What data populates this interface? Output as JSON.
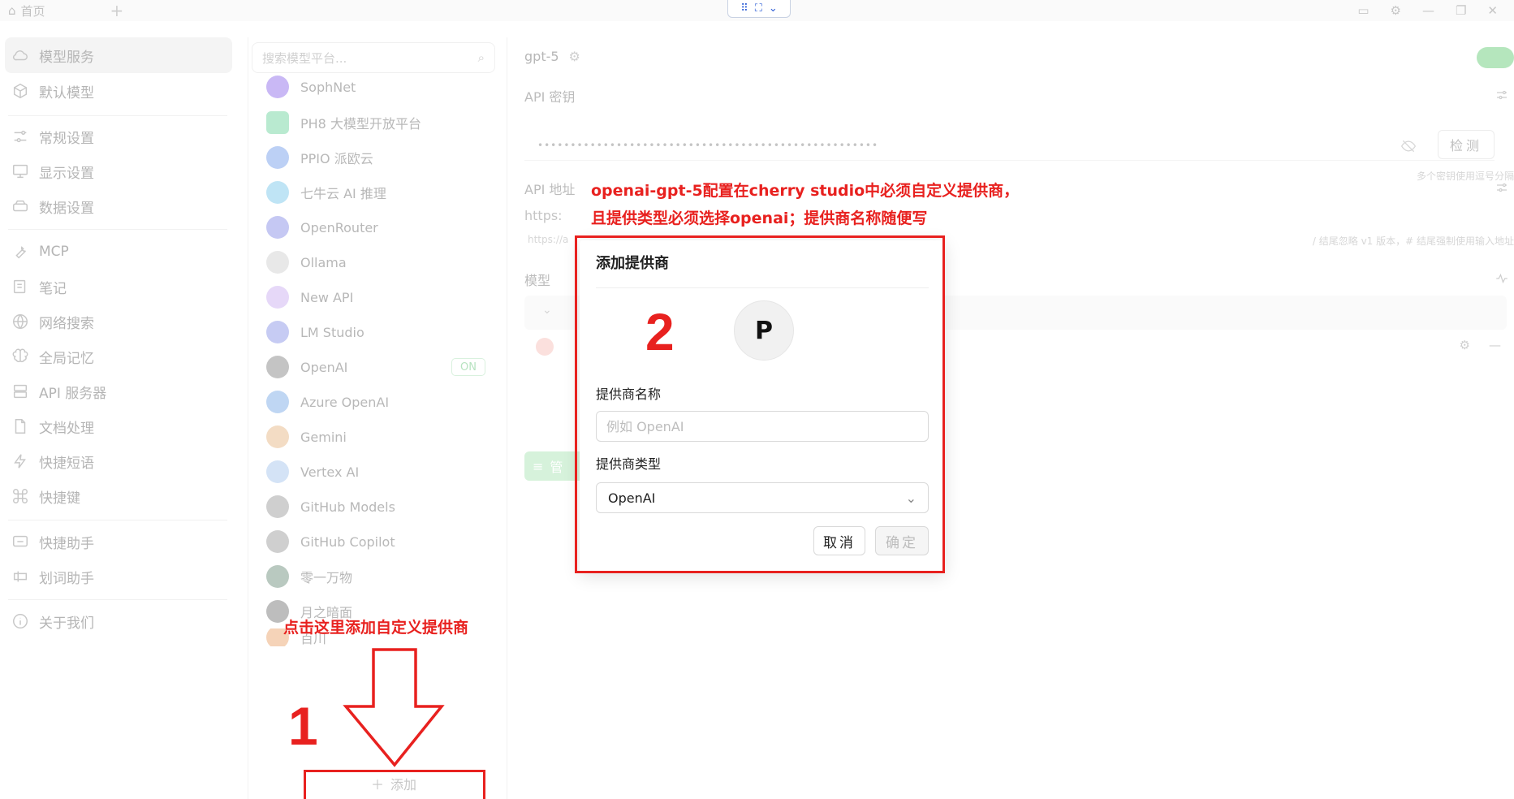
{
  "titlebar": {
    "home_tab": "首页",
    "add_tab": "+"
  },
  "sidebar": {
    "items": [
      {
        "label": "模型服务",
        "icon": "cloud-icon"
      },
      {
        "label": "默认模型",
        "icon": "cube-icon"
      },
      {
        "label": "常规设置",
        "icon": "sliders-icon"
      },
      {
        "label": "显示设置",
        "icon": "monitor-icon"
      },
      {
        "label": "数据设置",
        "icon": "database-icon"
      },
      {
        "label": "MCP",
        "icon": "wrench-icon"
      },
      {
        "label": "笔记",
        "icon": "note-icon"
      },
      {
        "label": "网络搜索",
        "icon": "globe-icon"
      },
      {
        "label": "全局记忆",
        "icon": "brain-icon"
      },
      {
        "label": "API 服务器",
        "icon": "server-icon"
      },
      {
        "label": "文档处理",
        "icon": "document-icon"
      },
      {
        "label": "快捷短语",
        "icon": "zap-icon"
      },
      {
        "label": "快捷键",
        "icon": "command-icon"
      },
      {
        "label": "快捷助手",
        "icon": "assistant-icon"
      },
      {
        "label": "划词助手",
        "icon": "text-select-icon"
      },
      {
        "label": "关于我们",
        "icon": "info-icon"
      }
    ]
  },
  "providers": {
    "search_placeholder": "搜索模型平台...",
    "items": [
      {
        "label": "SophNet",
        "color": "#c9b8f5"
      },
      {
        "label": "PH8 大模型开放平台",
        "color": "#b9ead0"
      },
      {
        "label": "PPIO 派欧云",
        "color": "#bcd0f5"
      },
      {
        "label": "七牛云 AI 推理",
        "color": "#bfe4f5"
      },
      {
        "label": "OpenRouter",
        "color": "#c5c8f3"
      },
      {
        "label": "Ollama",
        "color": "#e8e8e8"
      },
      {
        "label": "New API",
        "color": "#e6d8f8"
      },
      {
        "label": "LM Studio",
        "color": "#c6cbf3"
      },
      {
        "label": "OpenAI",
        "color": "#c4c4c4",
        "badge": "ON"
      },
      {
        "label": "Azure OpenAI",
        "color": "#bfd6f3"
      },
      {
        "label": "Gemini",
        "color": "#f3dcc4"
      },
      {
        "label": "Vertex AI",
        "color": "#d4e3f6"
      },
      {
        "label": "GitHub Models",
        "color": "#cfcfcf"
      },
      {
        "label": "GitHub Copilot",
        "color": "#cfcfcf"
      },
      {
        "label": "零一万物",
        "color": "#b9c9c0"
      },
      {
        "label": "月之暗面",
        "color": "#bdbdbd"
      },
      {
        "label": "百川",
        "color": "#f5d3b8"
      }
    ],
    "add_label": "添加"
  },
  "main": {
    "model_title": "gpt-5",
    "api_key_label": "API 密钥",
    "api_key_value": "••••••••••••••••••••••••••••••••••••••••••••••••••••",
    "check_label": "检测",
    "key_hint": "多个密钥使用逗号分隔",
    "api_url_label": "API 地址",
    "api_url_value": "https:",
    "url_hint_left": "https://a",
    "url_hint_right": "/ 结尾忽略 v1 版本，# 结尾强制使用输入地址",
    "models_label": "模型",
    "manage_label": "管"
  },
  "dialog": {
    "title": "添加提供商",
    "avatar_letter": "P",
    "name_label": "提供商名称",
    "name_placeholder": "例如 OpenAI",
    "type_label": "提供商类型",
    "type_value": "OpenAI",
    "cancel_label": "取消",
    "ok_label": "确定"
  },
  "annotations": {
    "note_top_line1": "openai-gpt-5配置在cherry studio中必须自定义提供商，",
    "note_top_line2": "且提供类型必须选择openai；提供商名称随便写",
    "note_add": "点击这里添加自定义提供商",
    "step1": "1",
    "step2": "2"
  }
}
